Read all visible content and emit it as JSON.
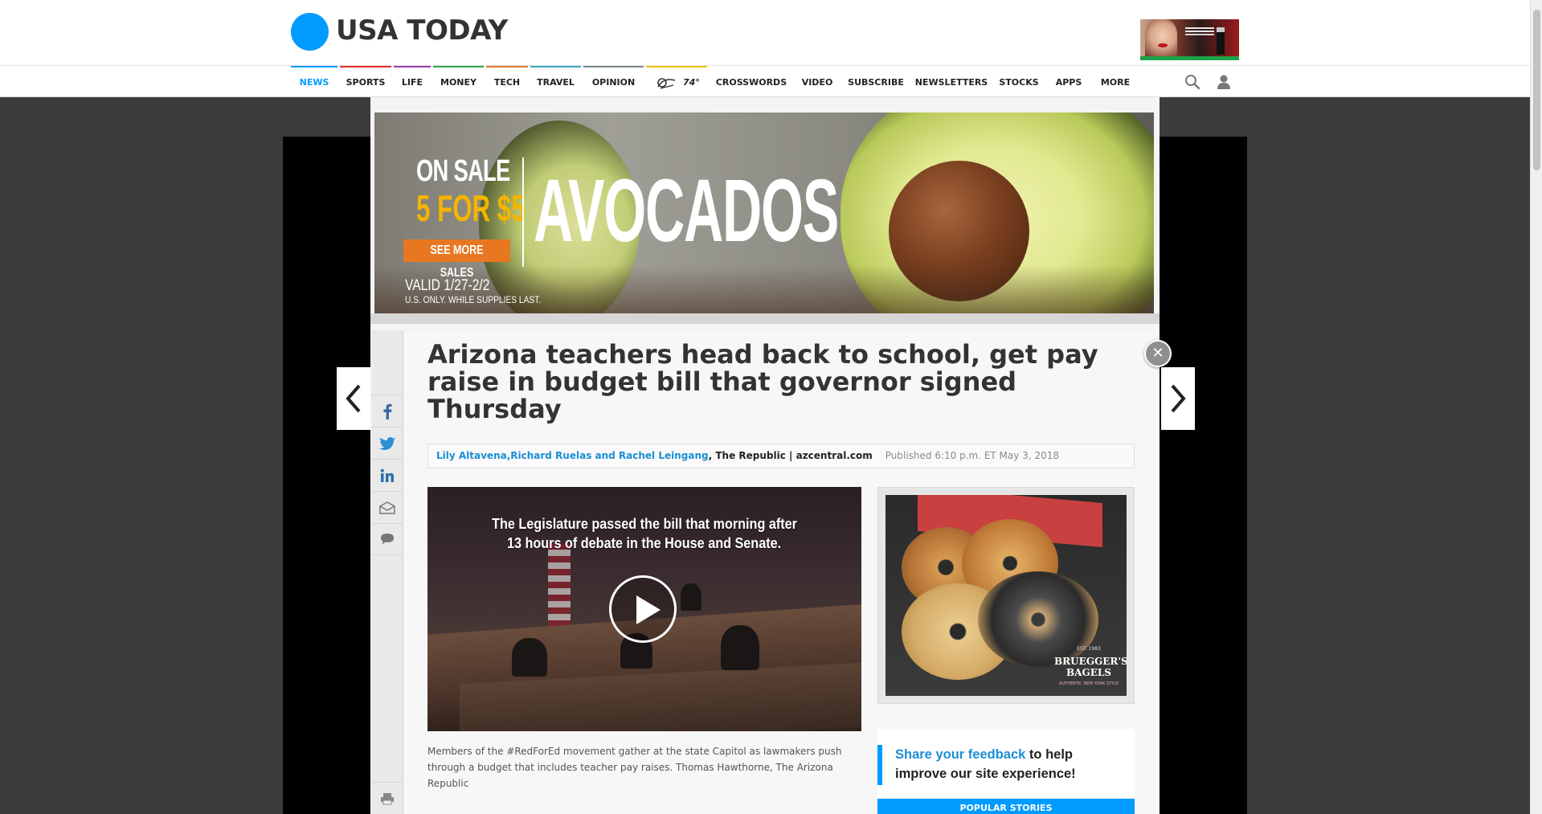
{
  "header": {
    "logo_text": "USA TODAY",
    "brand_color": "#009bff"
  },
  "nav": {
    "items": [
      {
        "label": "NEWS",
        "active": true,
        "accent": "#009bff"
      },
      {
        "label": "SPORTS",
        "accent": "#e52f2f"
      },
      {
        "label": "LIFE",
        "accent": "#a03fb3"
      },
      {
        "label": "MONEY",
        "accent": "#33a34d"
      },
      {
        "label": "TECH",
        "accent": "#e57a25"
      },
      {
        "label": "TRAVEL",
        "accent": "#3aa9c7"
      },
      {
        "label": "OPINION",
        "accent": "#7a8a8f"
      },
      {
        "label": "74°",
        "accent": "#f0c419",
        "icon": "weather-icon"
      },
      {
        "label": "CROSSWORDS"
      },
      {
        "label": "VIDEO"
      },
      {
        "label": "SUBSCRIBE"
      },
      {
        "label": "NEWSLETTERS"
      },
      {
        "label": "STOCKS"
      },
      {
        "label": "APPS"
      },
      {
        "label": "MORE"
      }
    ],
    "search_icon": "search-icon",
    "user_icon": "user-icon"
  },
  "top_ad": {
    "on_sale": "ON SALE",
    "deal": "5 FOR $5",
    "cta": "SEE MORE SALES",
    "headline": "AVOCADOS",
    "valid": "VALID 1/27-2/2",
    "fine_print": "U.S. ONLY. WHILE SUPPLIES LAST."
  },
  "article": {
    "headline": "Arizona teachers head back to school, get pay raise in budget bill that governor signed Thursday",
    "authors": "Lily Altavena,Richard Ruelas and Rachel Leingang",
    "source": ", The Republic | azcentral.com",
    "published": "Published 6:10 p.m. ET May 3, 2018",
    "video_text_line1": "The Legislature passed the bill that morning after",
    "video_text_line2": "13 hours of debate in the House and Senate.",
    "caption": "Members of the #RedForEd movement gather at the state Capitol as lawmakers push through a budget that includes teacher pay raises. Thomas Hawthorne, The Arizona Republic"
  },
  "side_ad": {
    "brand": "BRUEGGER'S BAGELS",
    "bag_text": "NEW YORK STYLE"
  },
  "feedback": {
    "link": "Share your feedback",
    "rest": " to help improve our site experience!"
  },
  "popular": {
    "label": "POPULAR STORIES"
  },
  "share": {
    "icons": [
      "facebook-icon",
      "twitter-icon",
      "linkedin-icon",
      "email-icon",
      "comment-icon",
      "print-icon"
    ]
  }
}
